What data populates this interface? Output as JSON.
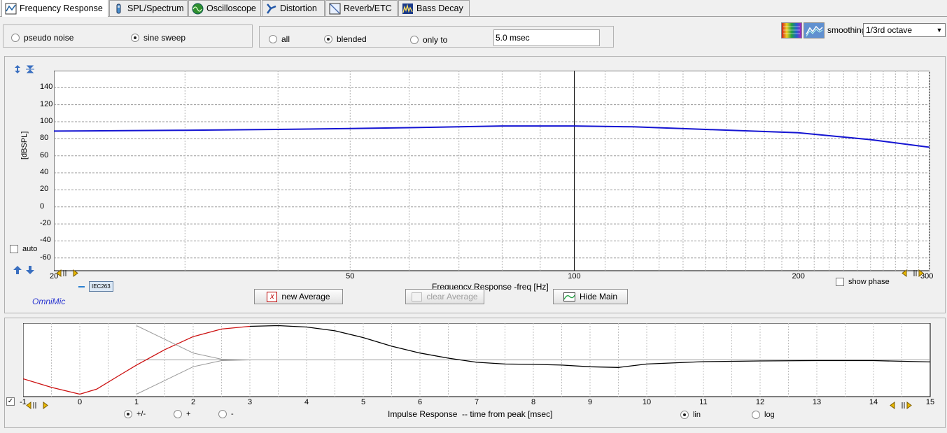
{
  "tabs": [
    {
      "label": "Frequency Response",
      "icon": "frequency-response-icon",
      "active": true
    },
    {
      "label": "SPL/Spectrum",
      "icon": "spl-spectrum-icon"
    },
    {
      "label": "Oscilloscope",
      "icon": "oscilloscope-icon"
    },
    {
      "label": "Distortion",
      "icon": "distortion-icon"
    },
    {
      "label": "Reverb/ETC",
      "icon": "reverb-etc-icon"
    },
    {
      "label": "Bass Decay",
      "icon": "bass-decay-icon"
    }
  ],
  "signal": {
    "pseudo_noise": "pseudo noise",
    "sine_sweep": "sine sweep",
    "selected": "sine sweep"
  },
  "window": {
    "all": "all",
    "blended": "blended",
    "only_to": "only to",
    "selected": "blended",
    "time_value": "5.0 msec"
  },
  "smoothing": {
    "label": "smoothing",
    "value": "1/3rd octave"
  },
  "freq_chart": {
    "ylabel": "[dBSPL]",
    "xlabel": "Frequency Response -freq [Hz]",
    "auto_label": "auto",
    "show_phase_label": "show phase",
    "legend_tag": "IEC263",
    "brand": "OmniMic",
    "x_start_label": "20",
    "x_end_label": "300"
  },
  "buttons": {
    "new_average": "new Average",
    "clear_average": "clear Average",
    "hide_main": "Hide Main"
  },
  "impulse": {
    "xlabel": "Impulse Response  -- time from peak [msec]",
    "pm": "+/-",
    "plus": "+",
    "minus": "-",
    "sign_selected": "+/-",
    "lin": "lin",
    "log": "log",
    "scale_selected": "lin"
  },
  "chart_data": [
    {
      "type": "line",
      "title": "",
      "xlabel": "Frequency Response -freq [Hz]",
      "ylabel": "[dBSPL]",
      "xscale": "log",
      "xlim": [
        20,
        300
      ],
      "ylim": [
        -75,
        160
      ],
      "yticks": [
        140,
        120,
        100,
        80,
        60,
        40,
        20,
        0,
        -20,
        -40,
        -60
      ],
      "xticks": [
        50,
        100,
        200
      ],
      "grid": true,
      "cursor_x": 100,
      "series": [
        {
          "color": "#1414d2",
          "x": [
            20,
            25,
            30,
            40,
            50,
            60,
            70,
            80,
            100,
            120,
            150,
            200,
            250,
            300
          ],
          "y": [
            89,
            89.5,
            90,
            91,
            92,
            93,
            94,
            95,
            95,
            94,
            91,
            87,
            79,
            70
          ]
        }
      ]
    },
    {
      "type": "line",
      "title": "",
      "xlabel": "Impulse Response  -- time from peak [msec]",
      "xlim": [
        -1,
        15
      ],
      "xticks": [
        -1,
        0,
        1,
        2,
        3,
        4,
        5,
        6,
        7,
        8,
        9,
        10,
        11,
        12,
        13,
        14,
        15
      ],
      "grid": true,
      "series": [
        {
          "color": "#cc1010",
          "x": [
            -1,
            -0.5,
            0,
            0.3,
            0.7,
            1,
            1.5,
            2,
            2.5,
            3
          ],
          "y": [
            -0.55,
            -0.8,
            -1.0,
            -0.85,
            -0.45,
            -0.15,
            0.3,
            0.68,
            0.9,
            0.98
          ]
        },
        {
          "color": "#000000",
          "x": [
            3,
            3.5,
            4,
            4.5,
            5,
            5.5,
            6,
            6.5,
            7,
            7.5,
            8,
            8.5,
            9,
            9.5,
            10,
            11,
            12,
            13,
            14,
            15
          ],
          "y": [
            0.98,
            1.0,
            0.96,
            0.85,
            0.65,
            0.4,
            0.2,
            0.05,
            -0.07,
            -0.12,
            -0.13,
            -0.15,
            -0.2,
            -0.22,
            -0.12,
            -0.05,
            -0.03,
            -0.02,
            -0.02,
            -0.06
          ]
        },
        {
          "color": "#9a9a9a",
          "x": [
            1,
            1.5,
            2,
            2.5,
            3
          ],
          "y": [
            1.0,
            0.6,
            0.2,
            0.02,
            0.0
          ]
        },
        {
          "color": "#9a9a9a",
          "x": [
            1,
            1.5,
            2,
            2.5,
            3
          ],
          "y": [
            -1.0,
            -0.6,
            -0.2,
            -0.02,
            0.0
          ]
        }
      ]
    }
  ]
}
